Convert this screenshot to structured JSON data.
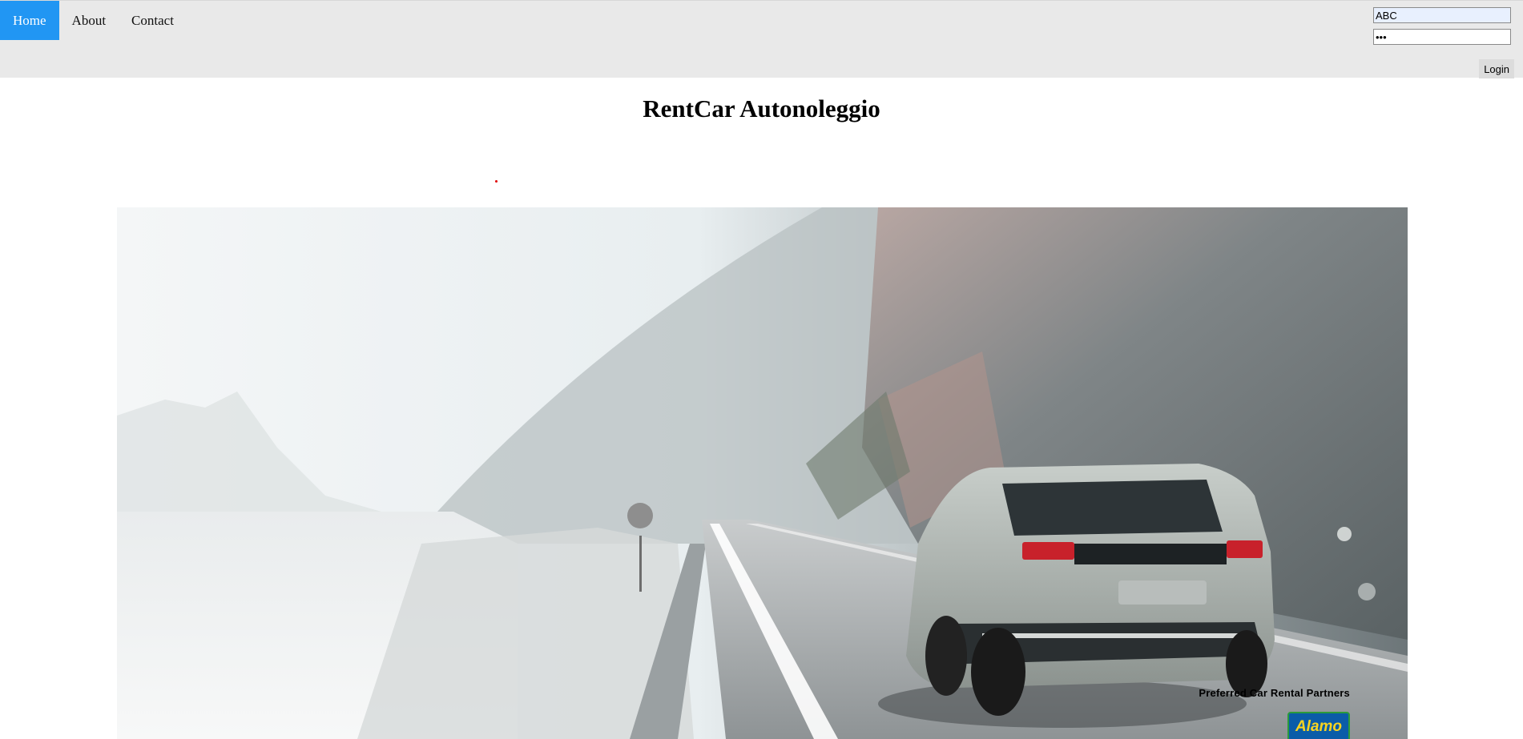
{
  "nav": {
    "items": [
      {
        "label": "Home",
        "active": true
      },
      {
        "label": "About",
        "active": false
      },
      {
        "label": "Contact",
        "active": false
      }
    ]
  },
  "login": {
    "username_value": "ABC",
    "password_value": "•••",
    "button_label": "Login"
  },
  "page": {
    "title": "RentCar Autonoleggio"
  },
  "hero": {
    "image_subject": "silver SUV driving on mountain road",
    "partners_label": "Preferred Car Rental Partners",
    "partner_logo_text": "Alamo"
  },
  "colors": {
    "nav_active": "#2196f3",
    "topbar_bg": "#e9e9e9",
    "marker_red": "#e00000"
  }
}
